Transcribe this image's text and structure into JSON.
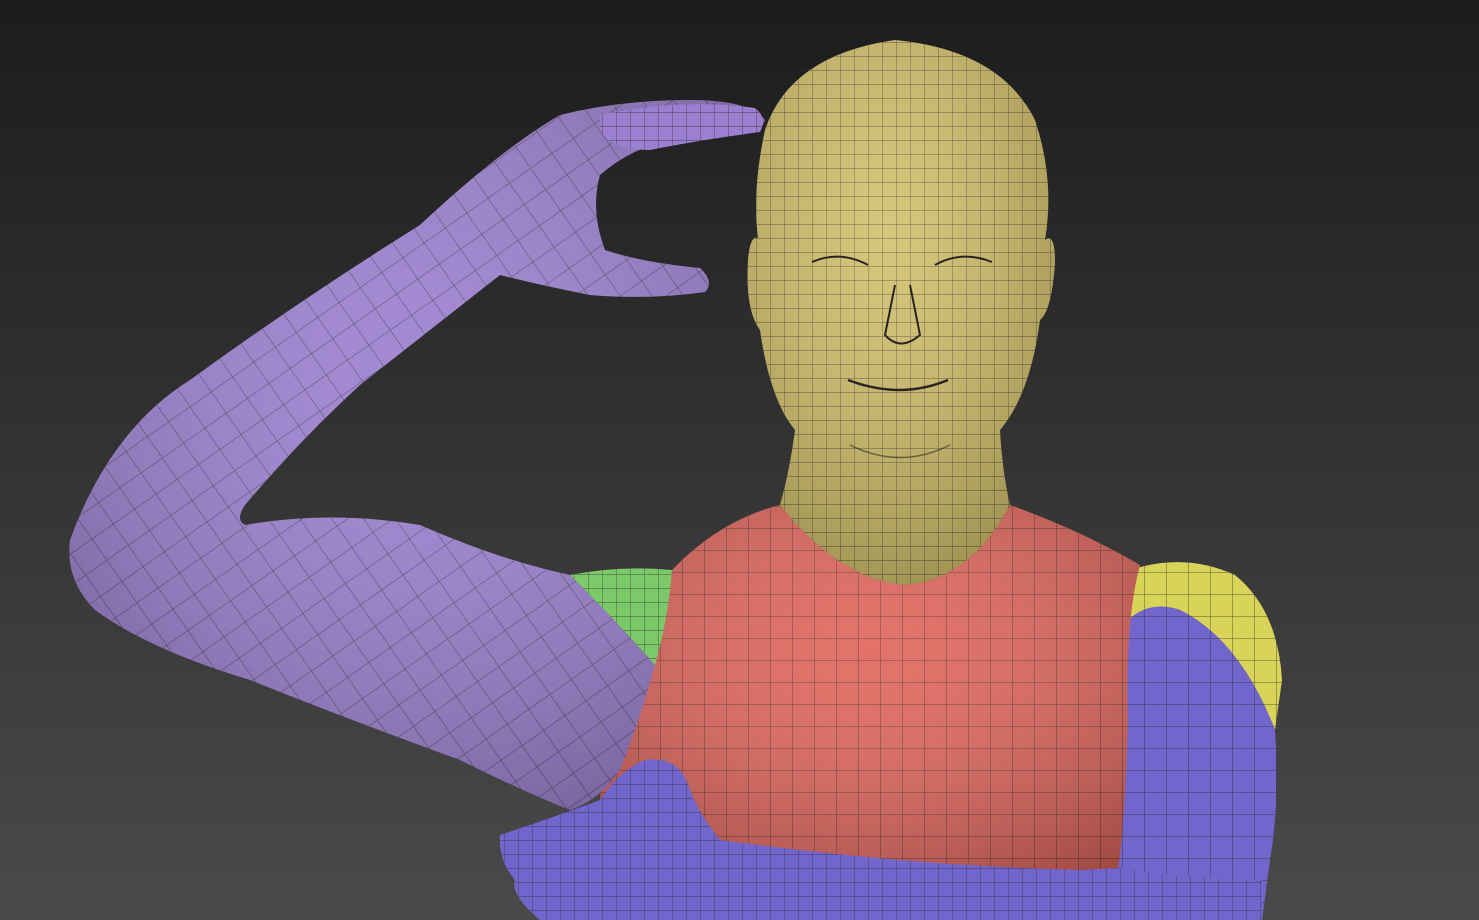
{
  "scene": {
    "subject": "polygroup-colored-base-mesh",
    "colors": {
      "background_top": "#1c1c1c",
      "background_bottom": "#4a4a4a",
      "head_neck": "#d2c06a",
      "chest": "#e0665c",
      "shoulder_left": "#7cc96a",
      "shoulder_right": "#d8d45a",
      "arm_raised": "#9b7fd0",
      "arm_crossed": "#7266cc",
      "wire": "#2a2420"
    }
  }
}
